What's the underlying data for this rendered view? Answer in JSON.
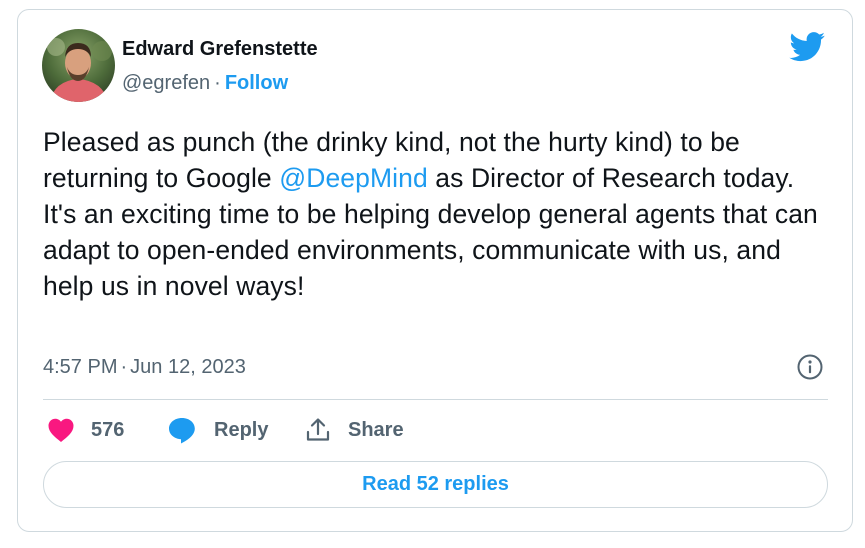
{
  "author": {
    "name": "Edward Grefenstette",
    "handle": "@egrefen",
    "separator": "·",
    "follow_label": "Follow"
  },
  "tweet": {
    "text_before": "Pleased as punch (the drinky kind, not the hurty kind) to be returning to Google ",
    "mention": "@DeepMind",
    "text_after": " as Director of Research today. It's an exciting time to be helping develop general agents that can adapt to open-ended environments, communicate with us, and help us in novel ways!"
  },
  "meta": {
    "time": "4:57 PM",
    "separator": "·",
    "date": "Jun 12, 2023"
  },
  "actions": {
    "likes_count": "576",
    "reply_label": "Reply",
    "share_label": "Share"
  },
  "read_replies_label": "Read 52 replies",
  "icons": {
    "brand": "twitter-bird-icon",
    "info": "info-icon",
    "like": "heart-icon",
    "reply": "speech-bubble-icon",
    "share": "share-arrow-icon"
  },
  "colors": {
    "accent": "#1d9bf0",
    "like": "#f91880",
    "text": "#0f1419",
    "secondary": "#536471",
    "border": "#cfd9de"
  }
}
